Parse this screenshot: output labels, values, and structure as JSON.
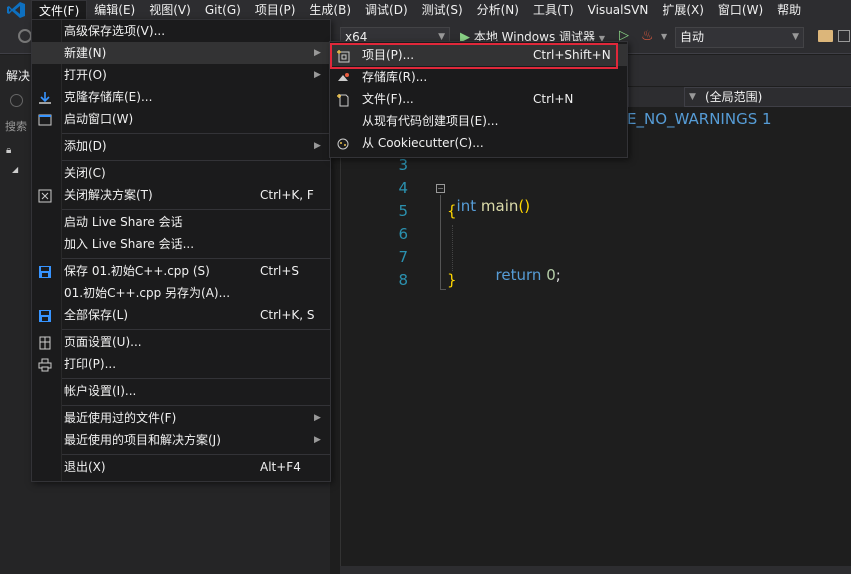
{
  "menubar": {
    "items": [
      "文件(F)",
      "编辑(E)",
      "视图(V)",
      "Git(G)",
      "项目(P)",
      "生成(B)",
      "调试(D)",
      "测试(S)",
      "分析(N)",
      "工具(T)",
      "VisualSVN",
      "扩展(X)",
      "窗口(W)",
      "帮助"
    ]
  },
  "toolbar": {
    "platform": "x64",
    "run_label": "本地 Windows 调试器",
    "config": "自动"
  },
  "left_panel": {
    "tab_label": "解决",
    "search_label": "搜索"
  },
  "editor": {
    "scope": "(全局范围)",
    "line1_text": "_CRT_SECURE_NO_WARNINGS 1",
    "line1_visible": "E_NO_WARNINGS 1",
    "lines": [
      "3",
      "4",
      "5",
      "6",
      "7",
      "8"
    ],
    "code_int": "int",
    "code_main": "main",
    "code_parens": "()",
    "code_open_brace": "{",
    "code_return": "return",
    "code_zero": "0",
    "code_semicolon": ";",
    "code_close_brace": "}"
  },
  "file_menu": {
    "items": [
      {
        "label": "高级保存选项(V)...",
        "shortcut": "",
        "sub": false
      },
      {
        "label": "新建(N)",
        "shortcut": "",
        "sub": true
      },
      {
        "label": "打开(O)",
        "shortcut": "",
        "sub": true
      },
      {
        "label": "克隆存储库(E)...",
        "shortcut": "",
        "sub": false
      },
      {
        "label": "启动窗口(W)",
        "shortcut": "",
        "sub": false
      },
      {
        "label": "添加(D)",
        "shortcut": "",
        "sub": true
      },
      {
        "label": "关闭(C)",
        "shortcut": "",
        "sub": false
      },
      {
        "label": "关闭解决方案(T)",
        "shortcut": "Ctrl+K, F",
        "sub": false
      },
      {
        "label": "启动 Live Share 会话",
        "shortcut": "",
        "sub": false
      },
      {
        "label": "加入 Live Share 会话...",
        "shortcut": "",
        "sub": false
      },
      {
        "label": "保存 01.初始C++.cpp (S)",
        "shortcut": "Ctrl+S",
        "sub": false
      },
      {
        "label": "01.初始C++.cpp 另存为(A)...",
        "shortcut": "",
        "sub": false
      },
      {
        "label": "全部保存(L)",
        "shortcut": "Ctrl+K, S",
        "sub": false
      },
      {
        "label": "页面设置(U)...",
        "shortcut": "",
        "sub": false
      },
      {
        "label": "打印(P)...",
        "shortcut": "",
        "sub": false
      },
      {
        "label": "帐户设置(I)...",
        "shortcut": "",
        "sub": false
      },
      {
        "label": "最近使用过的文件(F)",
        "shortcut": "",
        "sub": true
      },
      {
        "label": "最近使用的项目和解决方案(J)",
        "shortcut": "",
        "sub": true
      },
      {
        "label": "退出(X)",
        "shortcut": "Alt+F4",
        "sub": false
      }
    ]
  },
  "new_submenu": {
    "items": [
      {
        "label": "项目(P)...",
        "shortcut": "Ctrl+Shift+N"
      },
      {
        "label": "存储库(R)...",
        "shortcut": ""
      },
      {
        "label": "文件(F)...",
        "shortcut": "Ctrl+N"
      },
      {
        "label": "从现有代码创建项目(E)...",
        "shortcut": ""
      },
      {
        "label": "从 Cookiecutter(C)...",
        "shortcut": ""
      }
    ]
  },
  "colors": {
    "accent": "#007acc",
    "highlight_box": "#e0283a",
    "keyword": "#569cd6",
    "line_number": "#2b91af"
  }
}
